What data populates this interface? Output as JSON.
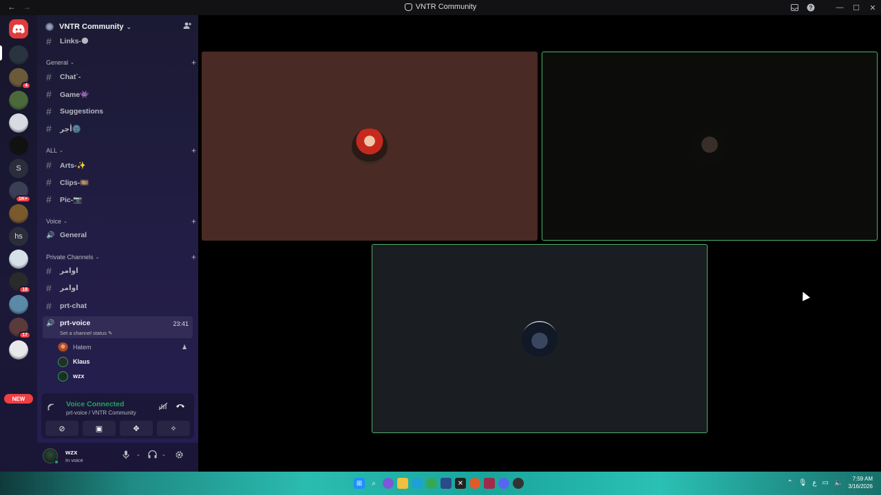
{
  "titlebar": {
    "back": "←",
    "forward": "→",
    "title": "VNTR Community",
    "inbox_icon": "inbox-icon",
    "help_icon": "help-icon",
    "minimize": "—",
    "maximize": "☐",
    "close": "✕"
  },
  "rail": {
    "home_icon": "discord-icon",
    "servers": [
      {
        "name": "server-1",
        "badge": "",
        "color": "#2a3340"
      },
      {
        "name": "server-2",
        "badge": "4",
        "color": "#6a5a3a"
      },
      {
        "name": "server-3",
        "badge": "",
        "color": "#4a6a3a"
      },
      {
        "name": "server-4",
        "badge": "",
        "color": "#d8dbe2"
      },
      {
        "name": "server-5",
        "badge": "",
        "color": "#111111"
      },
      {
        "name": "server-6",
        "text": "S",
        "badge": ""
      },
      {
        "name": "server-7",
        "badge": "1K+",
        "color": "#3a3f55"
      },
      {
        "name": "server-8",
        "badge": "",
        "color": "#7a5a2a"
      },
      {
        "name": "server-9",
        "text": "hs",
        "badge": ""
      },
      {
        "name": "server-10",
        "badge": "",
        "color": "#d5e0e8"
      },
      {
        "name": "server-11",
        "badge": "18",
        "color": "#2a2a2a"
      },
      {
        "name": "server-12",
        "badge": "",
        "color": "#5a8aa8"
      },
      {
        "name": "server-13",
        "badge": "17",
        "color": "#5a3a3a"
      },
      {
        "name": "server-14",
        "badge": "",
        "color": "#e8e8ea"
      }
    ],
    "new_label": "NEW"
  },
  "guild": {
    "name": "VNTR Community",
    "chevron": "⌄",
    "invite_icon": "add-member-icon"
  },
  "channels": {
    "links": "Links-🌑",
    "general_category": "General",
    "chat": "Chat`-",
    "game": "Game👾",
    "suggestions": "Suggestions",
    "ajr": "أجر🌚",
    "all_category": "ALL",
    "arts": "Arts-✨",
    "clips": "Clips-🎞️",
    "pic": "Pic-📷",
    "voice_category": "Voice",
    "voice_general": "General",
    "private_category": "Private Channels",
    "awamer1": "اوامر",
    "awamer2": "اوامر",
    "prt_chat": "prt-chat",
    "prt_voice": "prt-voice",
    "prt_voice_timer": "23:41",
    "prt_voice_status": "Set a channel status ✎"
  },
  "voice_users": [
    {
      "name": "Hatem",
      "bold": false,
      "extra": "♟",
      "color": "#b04a2a"
    },
    {
      "name": "Klaus",
      "bold": true,
      "extra": "",
      "color": "#2a2a2a"
    },
    {
      "name": "wzx",
      "bold": true,
      "extra": "",
      "color": "#1e2e26"
    }
  ],
  "voice_panel": {
    "title": "Voice Connected",
    "subtitle": "prt-voice / VNTR Community",
    "signal_icon": "signal-icon",
    "noise_icon": "noise-suppression-icon",
    "disconnect_icon": "disconnect-icon",
    "actions": [
      {
        "name": "camera-off-button",
        "glyph": "⊘"
      },
      {
        "name": "screen-share-button",
        "glyph": "▣"
      },
      {
        "name": "activities-button",
        "glyph": "✥"
      },
      {
        "name": "soundboard-button",
        "glyph": "✧"
      }
    ]
  },
  "user": {
    "name": "wzx",
    "status": "In voice",
    "mic_icon": "microphone-icon",
    "headset_icon": "headset-icon",
    "settings_icon": "gear-icon"
  },
  "stage": {
    "tiles": [
      "participant-1",
      "participant-2",
      "participant-3"
    ],
    "speaking_color": "#4fb36a"
  },
  "taskbar": {
    "time": "7:59 AM",
    "date": "3/16/2026",
    "lang": "ع"
  }
}
